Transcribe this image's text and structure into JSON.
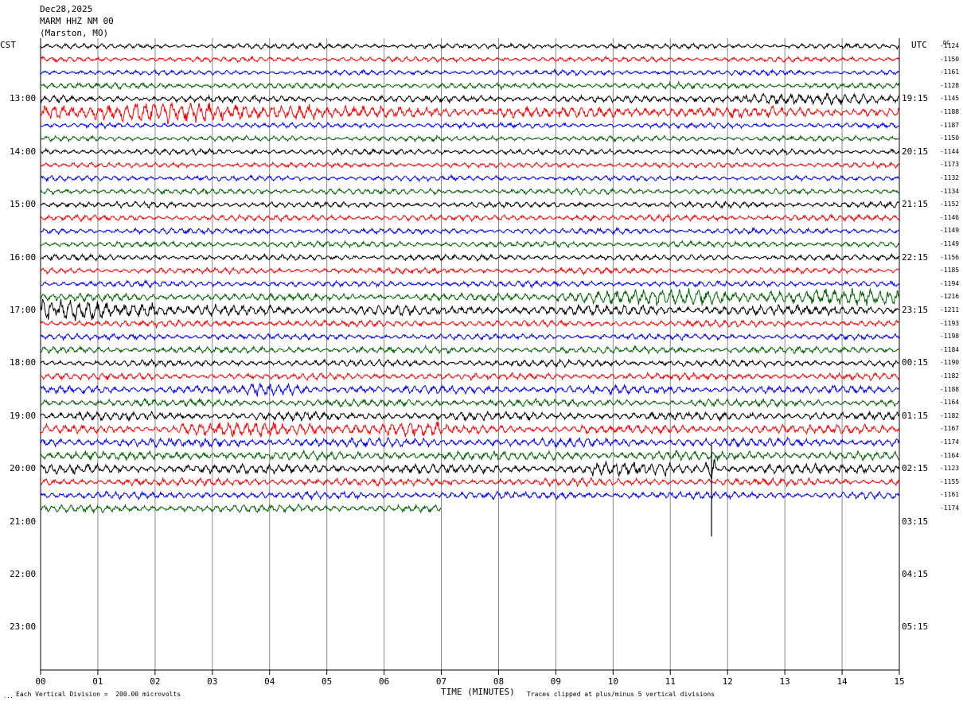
{
  "header": {
    "date": "Dec28,2025",
    "station": "MARM HHZ NM 00",
    "location": "(Marston, MO)"
  },
  "left_axis_title": "CST",
  "right_axis_title": "UTC",
  "dc_header": "DC",
  "left_hour_labels": [
    "13:00",
    "14:00",
    "15:00",
    "16:00",
    "17:00",
    "18:00",
    "19:00",
    "20:00",
    "21:00",
    "22:00",
    "23:00"
  ],
  "right_hour_labels": [
    "19:15",
    "20:15",
    "21:15",
    "22:15",
    "23:15",
    "00:15",
    "01:15",
    "02:15",
    "03:15",
    "04:15",
    "05:15"
  ],
  "dc_offsets": [
    "-1124",
    "-1150",
    "-1161",
    "-1128",
    "-1145",
    "-1188",
    "-1187",
    "-1150",
    "-1144",
    "-1173",
    "-1132",
    "-1134",
    "-1152",
    "-1146",
    "-1149",
    "-1149",
    "-1156",
    "-1185",
    "-1194",
    "-1216",
    "-1211",
    "-1193",
    "-1198",
    "-1184",
    "-1190",
    "-1182",
    "-1188",
    "-1164",
    "-1182",
    "-1167",
    "-1174",
    "-1164",
    "-1123",
    "-1155",
    "-1161",
    "-1174"
  ],
  "footer": {
    "scale": "Each Vertical Division =  200.00 microvolts",
    "clip": "Traces clipped at plus/minus 5 vertical divisions",
    "corner_mark": "..."
  },
  "chart_data": {
    "type": "line",
    "title": "MARM HHZ NM 00",
    "xlabel": "TIME (MINUTES)",
    "ylabel": "",
    "x_ticks": [
      "00",
      "01",
      "02",
      "03",
      "04",
      "05",
      "06",
      "07",
      "08",
      "09",
      "10",
      "11",
      "12",
      "13",
      "14",
      "15"
    ],
    "xlim": [
      0,
      15
    ],
    "minutes_per_line": 15,
    "lines_per_hour": 4,
    "first_line_hour_cst": 12.25,
    "line_colors": [
      "#000000",
      "#ff0000",
      "#0000ff",
      "#006400"
    ],
    "trace_count": 36,
    "last_trace_end_minute": 7.0,
    "trace_noise_level": [
      0.7,
      0.7,
      0.7,
      0.8,
      0.9,
      1.5,
      0.7,
      0.7,
      0.8,
      0.7,
      0.7,
      0.8,
      0.8,
      0.8,
      0.8,
      0.8,
      0.8,
      0.8,
      0.8,
      1.0,
      1.4,
      0.9,
      0.8,
      0.9,
      0.9,
      0.9,
      1.1,
      1.0,
      1.1,
      1.2,
      1.2,
      1.2,
      1.3,
      1.0,
      1.0,
      1.0
    ],
    "events": [
      {
        "trace": 4,
        "start_minute": 11.5,
        "end_minute": 15,
        "amplitude": 1.6
      },
      {
        "trace": 5,
        "start_minute": 0,
        "end_minute": 4.8,
        "amplitude": 1.8
      },
      {
        "trace": 19,
        "start_minute": 9.0,
        "end_minute": 15,
        "amplitude": 2.2
      },
      {
        "trace": 20,
        "start_minute": 0,
        "end_minute": 2.0,
        "amplitude": 2.2
      },
      {
        "trace": 26,
        "start_minute": 3.6,
        "end_minute": 4.6,
        "amplitude": 1.6
      },
      {
        "trace": 29,
        "start_minute": 2.4,
        "end_minute": 7.0,
        "amplitude": 1.6
      },
      {
        "trace": 32,
        "start_minute": 9.5,
        "end_minute": 11.0,
        "amplitude": 1.5
      },
      {
        "trace": 32,
        "start_minute": 11.6,
        "end_minute": 11.8,
        "amplitude": 3.5
      }
    ]
  }
}
